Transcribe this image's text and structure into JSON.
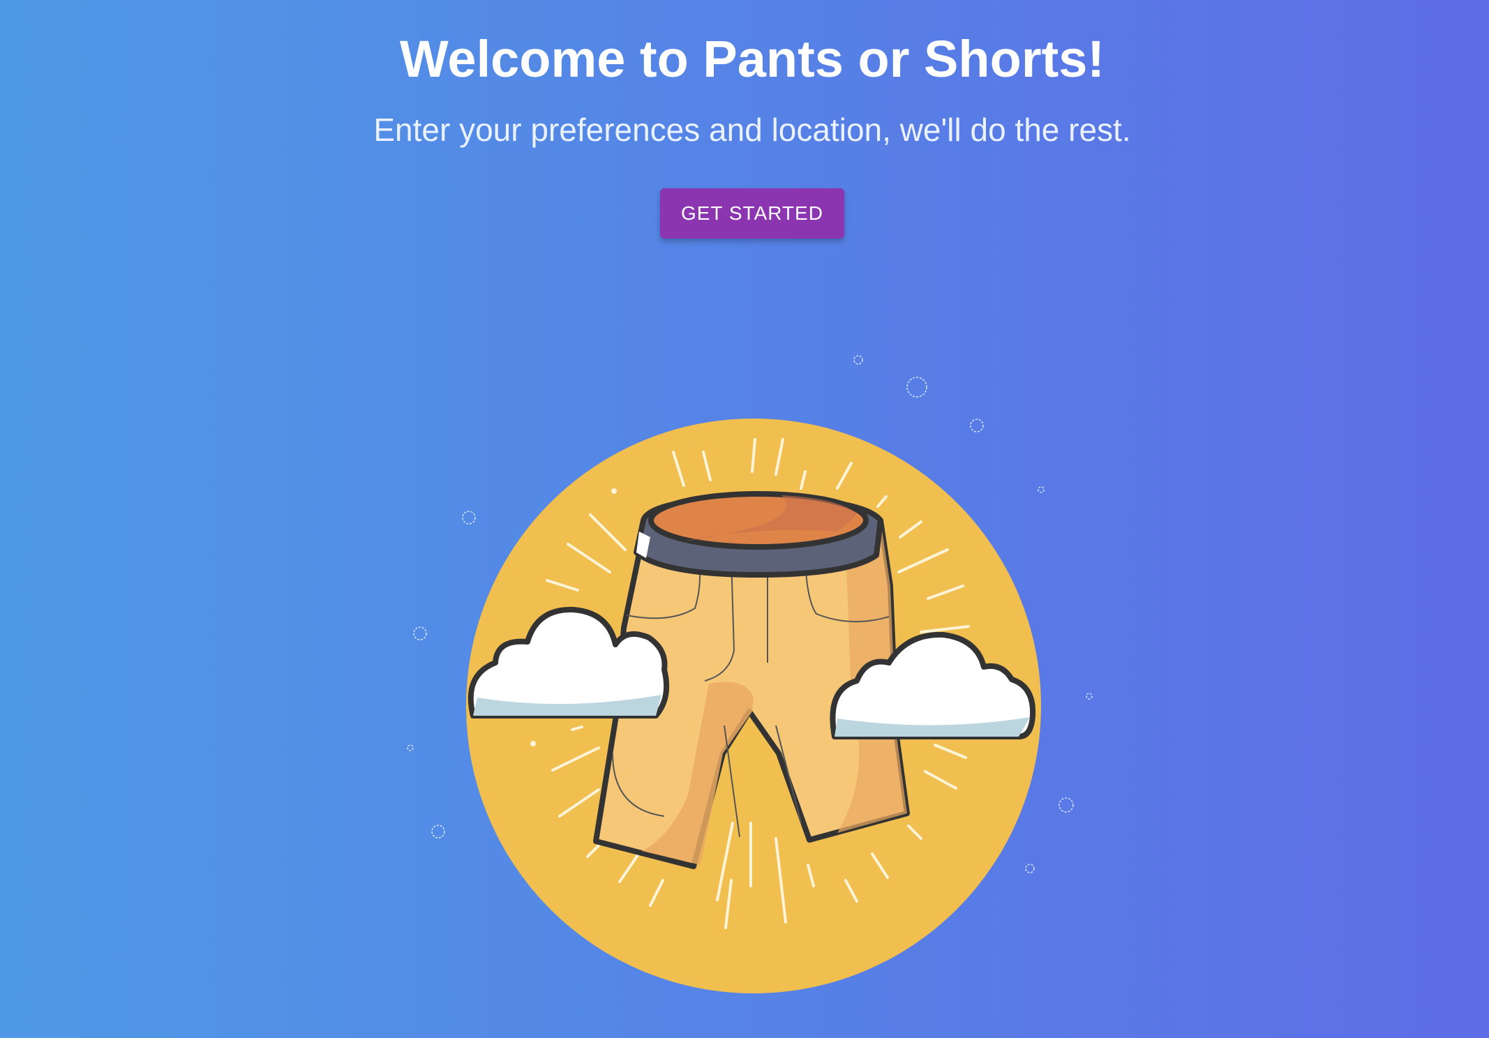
{
  "header": {
    "title": "Welcome to Pants or Shorts!",
    "subtitle": "Enter your preferences and location, we'll do the rest."
  },
  "cta": {
    "label": "GET STARTED"
  },
  "colors": {
    "background_start": "#4f99e6",
    "background_end": "#5e6de6",
    "button": "#8b35b0",
    "sun": "#f0bf4f",
    "shorts": "#f5c777",
    "waistband": "#5c6278",
    "shorts_top": "#df8448"
  },
  "illustration": {
    "icon": "shorts-with-clouds-illustration"
  }
}
